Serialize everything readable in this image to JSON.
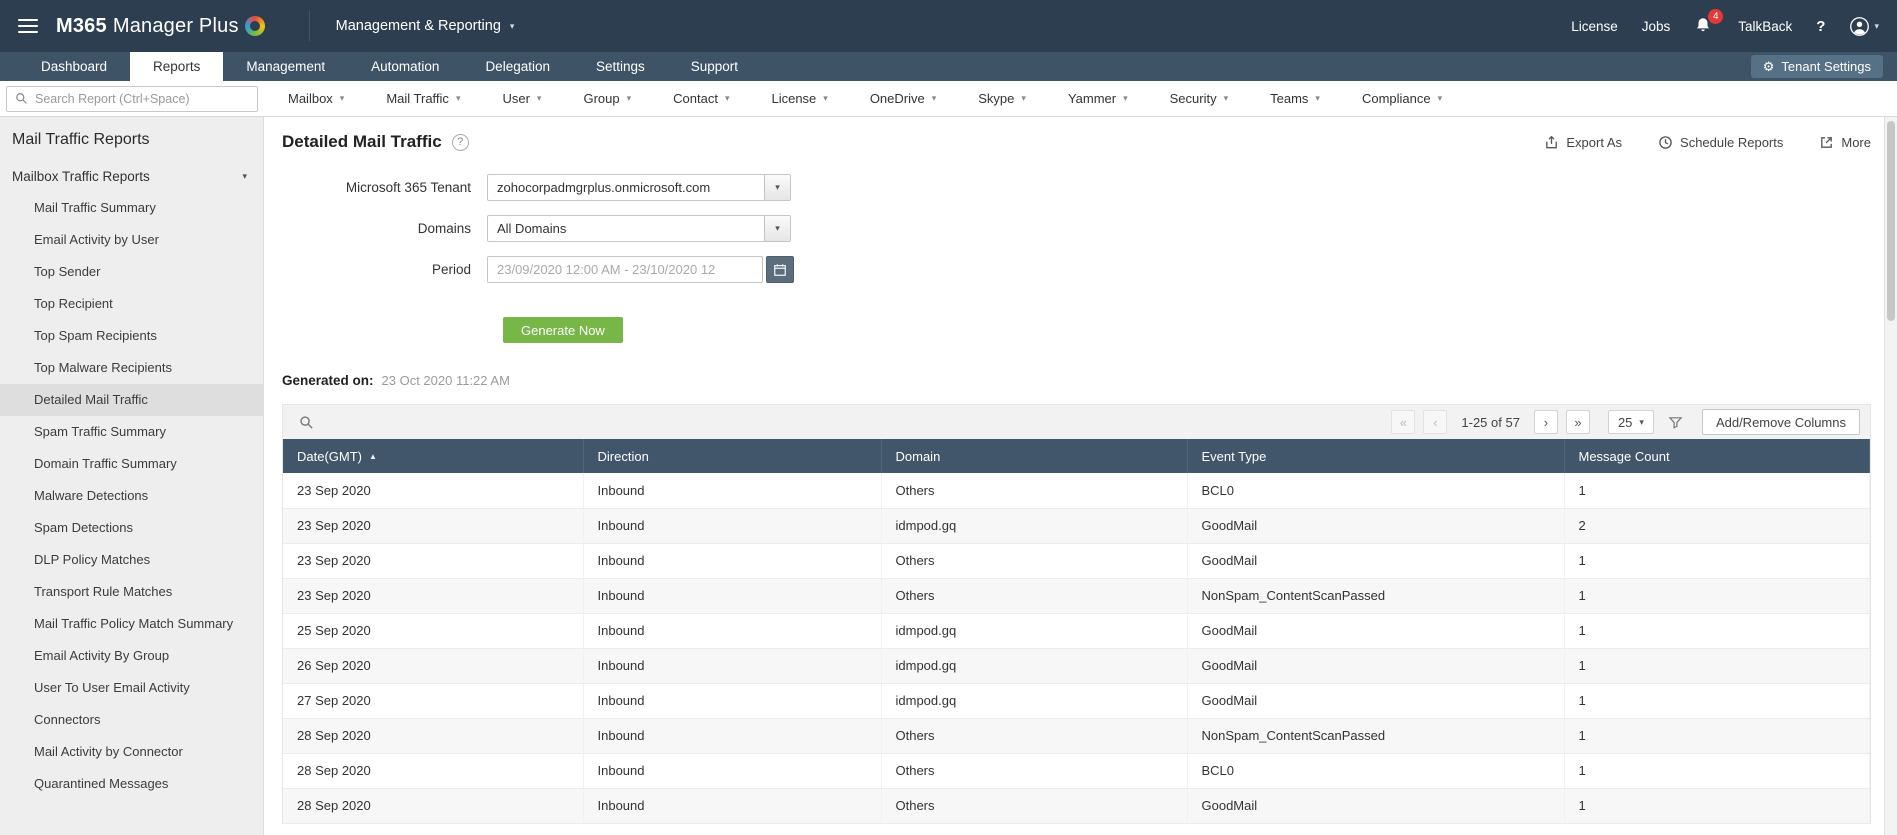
{
  "colors": {
    "topbar_bg": "#2d3e50",
    "tabs_bg": "#3e5366",
    "table_header_bg": "#42566b",
    "accent_green": "#76b747",
    "badge_red": "#e53935",
    "sidebar_bg": "#eeeeee"
  },
  "icons": {
    "caret_down": "▾",
    "sort_asc": "▲",
    "first_page": "«",
    "prev_page": "‹",
    "next_page": "›",
    "last_page": "»",
    "gear": "⚙",
    "help": "?"
  },
  "topbar": {
    "brand_bold": "M365",
    "brand_regular": "Manager Plus",
    "context_menu": "Management & Reporting",
    "license": "License",
    "jobs": "Jobs",
    "notification_count": "4",
    "talkback": "TalkBack",
    "help": "?"
  },
  "tabs": {
    "items": [
      {
        "label": "Dashboard"
      },
      {
        "label": "Reports",
        "active": true
      },
      {
        "label": "Management"
      },
      {
        "label": "Automation"
      },
      {
        "label": "Delegation"
      },
      {
        "label": "Settings"
      },
      {
        "label": "Support"
      }
    ],
    "tenant_settings": "Tenant Settings"
  },
  "category_bar": {
    "search_placeholder": "Search Report (Ctrl+Space)",
    "menus": [
      {
        "label": "Mailbox"
      },
      {
        "label": "Mail Traffic"
      },
      {
        "label": "User"
      },
      {
        "label": "Group"
      },
      {
        "label": "Contact"
      },
      {
        "label": "License"
      },
      {
        "label": "OneDrive"
      },
      {
        "label": "Skype"
      },
      {
        "label": "Yammer"
      },
      {
        "label": "Security"
      },
      {
        "label": "Teams"
      },
      {
        "label": "Compliance"
      }
    ]
  },
  "sidebar": {
    "title": "Mail Traffic Reports",
    "group_label": "Mailbox Traffic Reports",
    "items": [
      {
        "label": "Mail Traffic Summary"
      },
      {
        "label": "Email Activity by User"
      },
      {
        "label": "Top Sender"
      },
      {
        "label": "Top Recipient"
      },
      {
        "label": "Top Spam Recipients"
      },
      {
        "label": "Top Malware Recipients"
      },
      {
        "label": "Detailed Mail Traffic",
        "selected": true
      },
      {
        "label": "Spam Traffic Summary"
      },
      {
        "label": "Domain Traffic Summary"
      },
      {
        "label": "Malware Detections"
      },
      {
        "label": "Spam Detections"
      },
      {
        "label": "DLP Policy Matches"
      },
      {
        "label": "Transport Rule Matches"
      },
      {
        "label": "Mail Traffic Policy Match Summary"
      },
      {
        "label": "Email Activity By Group"
      },
      {
        "label": "User To User Email Activity"
      },
      {
        "label": "Connectors"
      },
      {
        "label": "Mail Activity by Connector"
      },
      {
        "label": "Quarantined Messages"
      }
    ]
  },
  "report": {
    "title": "Detailed Mail Traffic",
    "export_as": "Export As",
    "schedule_reports": "Schedule Reports",
    "more": "More",
    "form": {
      "tenant_label": "Microsoft 365 Tenant",
      "tenant_value": "zohocorpadmgrplus.onmicrosoft.com",
      "domains_label": "Domains",
      "domains_value": "All Domains",
      "period_label": "Period",
      "period_value": "23/09/2020 12:00 AM - 23/10/2020 12",
      "generate_button": "Generate Now"
    },
    "generated_on_label": "Generated on:",
    "generated_on_value": "23 Oct 2020 11:22 AM"
  },
  "table": {
    "page_info": "1-25 of 57",
    "page_size": "25",
    "add_remove_columns": "Add/Remove Columns",
    "columns": [
      "Date(GMT)",
      "Direction",
      "Domain",
      "Event Type",
      "Message Count"
    ],
    "rows": [
      [
        "23 Sep 2020",
        "Inbound",
        "Others",
        "BCL0",
        "1"
      ],
      [
        "23 Sep 2020",
        "Inbound",
        "idmpod.gq",
        "GoodMail",
        "2"
      ],
      [
        "23 Sep 2020",
        "Inbound",
        "Others",
        "GoodMail",
        "1"
      ],
      [
        "23 Sep 2020",
        "Inbound",
        "Others",
        "NonSpam_ContentScanPassed",
        "1"
      ],
      [
        "25 Sep 2020",
        "Inbound",
        "idmpod.gq",
        "GoodMail",
        "1"
      ],
      [
        "26 Sep 2020",
        "Inbound",
        "idmpod.gq",
        "GoodMail",
        "1"
      ],
      [
        "27 Sep 2020",
        "Inbound",
        "idmpod.gq",
        "GoodMail",
        "1"
      ],
      [
        "28 Sep 2020",
        "Inbound",
        "Others",
        "NonSpam_ContentScanPassed",
        "1"
      ],
      [
        "28 Sep 2020",
        "Inbound",
        "Others",
        "BCL0",
        "1"
      ],
      [
        "28 Sep 2020",
        "Inbound",
        "Others",
        "GoodMail",
        "1"
      ]
    ]
  }
}
